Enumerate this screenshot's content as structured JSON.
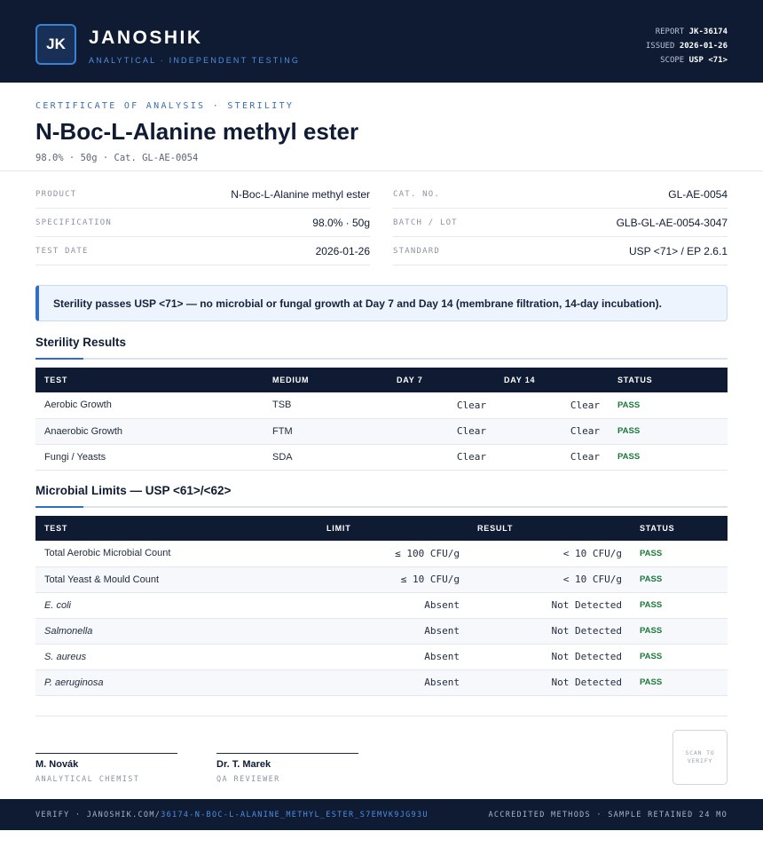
{
  "header": {
    "logo_initials": "JK",
    "brand": "JANOSHIK",
    "tagline": "ANALYTICAL · INDEPENDENT TESTING",
    "report_label": "REPORT",
    "report_value": "JK-36174",
    "issued_label": "ISSUED",
    "issued_value": "2026-01-26",
    "scope_label": "SCOPE",
    "scope_value": "USP <71>"
  },
  "title_block": {
    "eyebrow": "CERTIFICATE OF ANALYSIS · STERILITY",
    "title": "N-Boc-L-Alanine methyl ester",
    "subtitle": "98.0% · 50g  ·  Cat. GL-AE-0054"
  },
  "info": {
    "left": [
      {
        "label": "PRODUCT",
        "value": "N-Boc-L-Alanine methyl ester"
      },
      {
        "label": "SPECIFICATION",
        "value": "98.0% · 50g"
      },
      {
        "label": "TEST DATE",
        "value": "2026-01-26"
      }
    ],
    "right": [
      {
        "label": "CAT. NO.",
        "value": "GL-AE-0054"
      },
      {
        "label": "BATCH / LOT",
        "value": "GLB-GL-AE-0054-3047"
      },
      {
        "label": "STANDARD",
        "value": "USP <71> / EP 2.6.1"
      }
    ]
  },
  "callout": "Sterility passes USP <71> — no microbial or fungal growth at Day 7 and Day 14 (membrane filtration, 14-day incubation).",
  "sterility": {
    "title": "Sterility Results",
    "headers": [
      "TEST",
      "MEDIUM",
      "DAY 7",
      "DAY 14",
      "STATUS"
    ],
    "rows": [
      {
        "test": "Aerobic Growth",
        "medium": "TSB",
        "day7": "Clear",
        "day14": "Clear",
        "status": "PASS"
      },
      {
        "test": "Anaerobic Growth",
        "medium": "FTM",
        "day7": "Clear",
        "day14": "Clear",
        "status": "PASS"
      },
      {
        "test": "Fungi / Yeasts",
        "medium": "SDA",
        "day7": "Clear",
        "day14": "Clear",
        "status": "PASS"
      }
    ]
  },
  "microbial": {
    "title": "Microbial Limits — USP <61>/<62>",
    "headers": [
      "TEST",
      "LIMIT",
      "RESULT",
      "STATUS"
    ],
    "rows": [
      {
        "test": "Total Aerobic Microbial Count",
        "limit": "≤ 100 CFU/g",
        "result": "< 10 CFU/g",
        "status": "PASS"
      },
      {
        "test": "Total Yeast & Mould Count",
        "limit": "≤ 10 CFU/g",
        "result": "< 10 CFU/g",
        "status": "PASS"
      },
      {
        "test": "E. coli",
        "limit": "Absent",
        "result": "Not Detected",
        "status": "PASS"
      },
      {
        "test": "Salmonella",
        "limit": "Absent",
        "result": "Not Detected",
        "status": "PASS"
      },
      {
        "test": "S. aureus",
        "limit": "Absent",
        "result": "Not Detected",
        "status": "PASS"
      },
      {
        "test": "P. aeruginosa",
        "limit": "Absent",
        "result": "Not Detected",
        "status": "PASS"
      }
    ]
  },
  "signatures": [
    {
      "name": "M. Novák",
      "role": "ANALYTICAL CHEMIST"
    },
    {
      "name": "Dr. T. Marek",
      "role": "QA REVIEWER"
    }
  ],
  "qr_text": "SCAN TO VERIFY",
  "footer": {
    "verify_prefix": "VERIFY · JANOSHIK.COM/",
    "verify_link": "36174-N-BOC-L-ALANINE_METHYL_ESTER_S7EMVK9JG93U",
    "right": "ACCREDITED METHODS · SAMPLE RETAINED 24 MO"
  }
}
